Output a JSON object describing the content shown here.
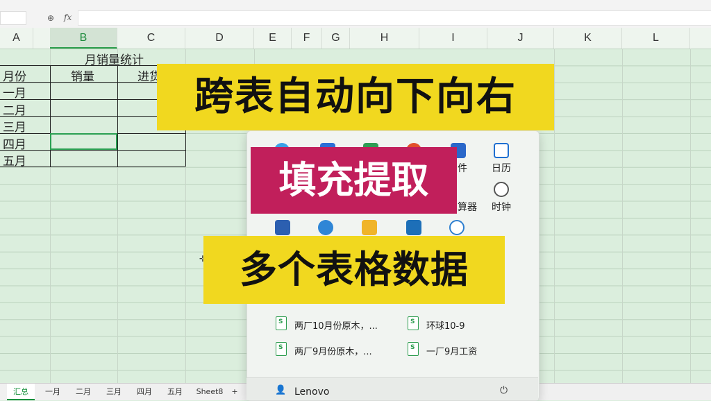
{
  "formula_bar": {
    "name_box": "",
    "fx_label": "fx",
    "formula": ""
  },
  "columns": [
    "A",
    "B",
    "C",
    "D",
    "E",
    "F",
    "G",
    "H",
    "I",
    "J",
    "K",
    "L"
  ],
  "selected_column": "B",
  "sheet": {
    "title": "月销量统计",
    "header": {
      "month": "月份",
      "sales": "销量",
      "stock": "进货"
    },
    "months": [
      "一月",
      "二月",
      "三月",
      "四月",
      "五月"
    ]
  },
  "start_menu": {
    "pinned_partial": [
      {
        "icon": "calendar-icon",
        "label": "日历",
        "color": "#1f6fd1"
      },
      {
        "icon": "clock-icon",
        "label": "时钟",
        "color": "#555555"
      }
    ],
    "partial_labels": {
      "files": "件",
      "calculator": "算器"
    },
    "recommended": [
      {
        "label": "两厂10月份原木，..."
      },
      {
        "label": "环球10-9"
      },
      {
        "label": "两厂9月份原木，..."
      },
      {
        "label": "一厂9月工资"
      }
    ],
    "user": "Lenovo"
  },
  "tabs": [
    "汇总",
    "一月",
    "二月",
    "三月",
    "四月",
    "五月",
    "Sheet8"
  ],
  "active_tab": "汇总",
  "add_tab": "+",
  "overlay": {
    "line1": "跨表自动向下向右",
    "line2": "填充提取",
    "line3": "多个表格数据"
  },
  "colors": {
    "accent": "#17913d",
    "banner_yellow": "#f1d81f",
    "banner_magenta": "#c11f5b"
  }
}
